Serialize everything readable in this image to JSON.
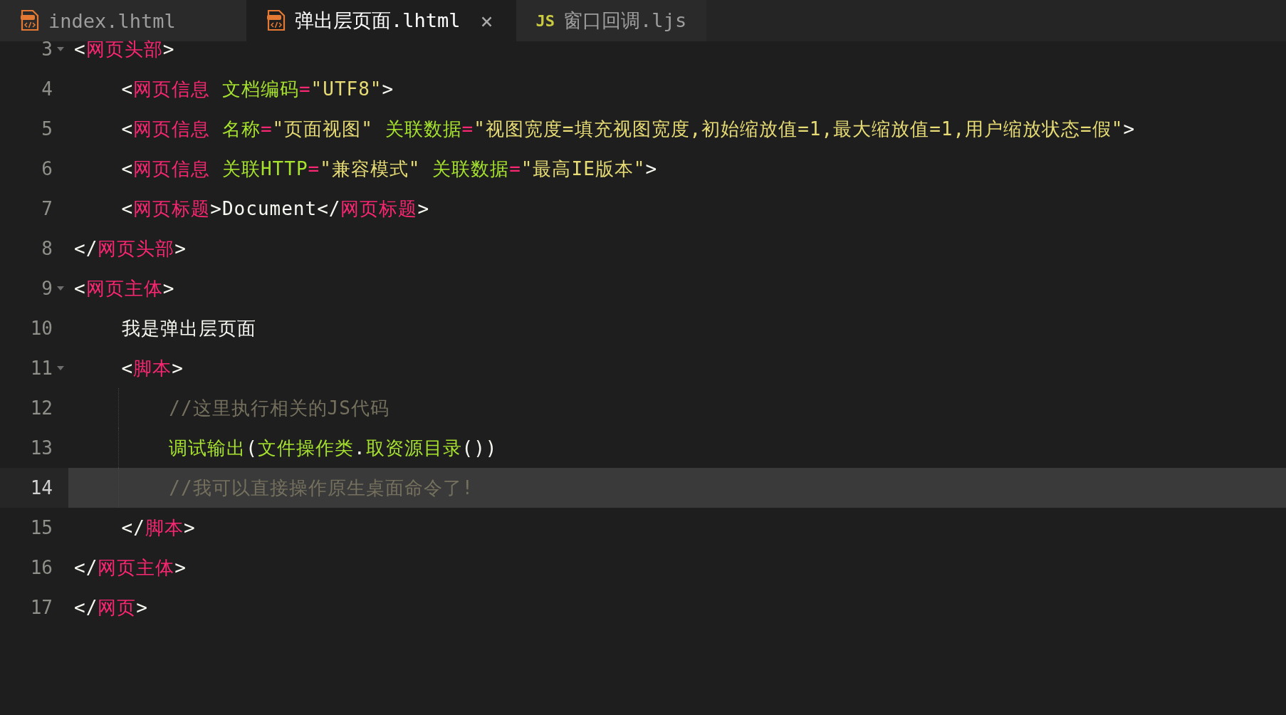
{
  "tabs": [
    {
      "label": "index.lhtml",
      "kind": "html",
      "selected": false
    },
    {
      "label": "弹出层页面.lhtml",
      "kind": "html",
      "selected": true,
      "close": "×"
    },
    {
      "label": "窗口回调.ljs",
      "kind": "js",
      "badge": "JS",
      "selected": false
    }
  ],
  "lines": [
    {
      "number": "3",
      "foldable": true,
      "selected": false,
      "tokens": [
        {
          "kind": "punct",
          "t": "<"
        },
        {
          "kind": "tag",
          "t": "网页头部"
        },
        {
          "kind": "punct",
          "t": ">"
        }
      ]
    },
    {
      "number": "4",
      "foldable": false,
      "selected": false,
      "tokens": [
        {
          "kind": "punct",
          "t": "    <"
        },
        {
          "kind": "tag",
          "t": "网页信息"
        },
        {
          "kind": "attr",
          "t": " 文档编码"
        },
        {
          "kind": "tag",
          "t": "="
        },
        {
          "kind": "string",
          "t": "\"UTF8\""
        },
        {
          "kind": "punct",
          "t": ">"
        }
      ]
    },
    {
      "number": "5",
      "foldable": false,
      "selected": false,
      "tokens": [
        {
          "kind": "punct",
          "t": "    <"
        },
        {
          "kind": "tag",
          "t": "网页信息"
        },
        {
          "kind": "attr",
          "t": " 名称"
        },
        {
          "kind": "tag",
          "t": "="
        },
        {
          "kind": "string",
          "t": "\"页面视图\""
        },
        {
          "kind": "attr",
          "t": " 关联数据"
        },
        {
          "kind": "tag",
          "t": "="
        },
        {
          "kind": "string",
          "t": "\"视图宽度=填充视图宽度,初始缩放值=1,最大缩放值=1,用户缩放状态=假\""
        },
        {
          "kind": "punct",
          "t": ">"
        }
      ]
    },
    {
      "number": "6",
      "foldable": false,
      "selected": false,
      "tokens": [
        {
          "kind": "punct",
          "t": "    <"
        },
        {
          "kind": "tag",
          "t": "网页信息"
        },
        {
          "kind": "attr",
          "t": " 关联HTTP"
        },
        {
          "kind": "tag",
          "t": "="
        },
        {
          "kind": "string",
          "t": "\"兼容模式\""
        },
        {
          "kind": "attr",
          "t": " 关联数据"
        },
        {
          "kind": "tag",
          "t": "="
        },
        {
          "kind": "string",
          "t": "\"最高IE版本\""
        },
        {
          "kind": "punct",
          "t": ">"
        }
      ]
    },
    {
      "number": "7",
      "foldable": false,
      "selected": false,
      "tokens": [
        {
          "kind": "punct",
          "t": "    <"
        },
        {
          "kind": "tag",
          "t": "网页标题"
        },
        {
          "kind": "punct",
          "t": ">Document</"
        },
        {
          "kind": "tag",
          "t": "网页标题"
        },
        {
          "kind": "punct",
          "t": ">"
        }
      ]
    },
    {
      "number": "8",
      "foldable": false,
      "selected": false,
      "tokens": [
        {
          "kind": "punct",
          "t": "</"
        },
        {
          "kind": "tag",
          "t": "网页头部"
        },
        {
          "kind": "punct",
          "t": ">"
        }
      ]
    },
    {
      "number": "9",
      "foldable": true,
      "selected": false,
      "tokens": [
        {
          "kind": "punct",
          "t": "<"
        },
        {
          "kind": "tag",
          "t": "网页主体"
        },
        {
          "kind": "punct",
          "t": ">"
        }
      ]
    },
    {
      "number": "10",
      "foldable": false,
      "selected": false,
      "tokens": [
        {
          "kind": "punct",
          "t": "    我是弹出层页面"
        }
      ]
    },
    {
      "number": "11",
      "foldable": true,
      "selected": false,
      "tokens": [
        {
          "kind": "punct",
          "t": "    <"
        },
        {
          "kind": "tag",
          "t": "脚本"
        },
        {
          "kind": "punct",
          "t": ">"
        }
      ]
    },
    {
      "number": "12",
      "foldable": false,
      "selected": false,
      "guide": true,
      "tokens": [
        {
          "kind": "comment",
          "t": "        //这里执行相关的JS代码"
        }
      ]
    },
    {
      "number": "13",
      "foldable": false,
      "selected": false,
      "guide": true,
      "tokens": [
        {
          "kind": "attr",
          "t": "        调试输出"
        },
        {
          "kind": "punct",
          "t": "("
        },
        {
          "kind": "attr",
          "t": "文件操作类"
        },
        {
          "kind": "punct",
          "t": "."
        },
        {
          "kind": "attr",
          "t": "取资源目录"
        },
        {
          "kind": "punct",
          "t": "())"
        }
      ]
    },
    {
      "number": "14",
      "foldable": false,
      "selected": true,
      "guide": true,
      "tokens": [
        {
          "kind": "comment",
          "t": "        //我可以直接操作原生桌面命令了!"
        }
      ]
    },
    {
      "number": "15",
      "foldable": false,
      "selected": false,
      "tokens": [
        {
          "kind": "punct",
          "t": "    </"
        },
        {
          "kind": "tag",
          "t": "脚本"
        },
        {
          "kind": "punct",
          "t": ">"
        }
      ]
    },
    {
      "number": "16",
      "foldable": false,
      "selected": false,
      "tokens": [
        {
          "kind": "punct",
          "t": "</"
        },
        {
          "kind": "tag",
          "t": "网页主体"
        },
        {
          "kind": "punct",
          "t": ">"
        }
      ]
    },
    {
      "number": "17",
      "foldable": false,
      "selected": false,
      "tokens": [
        {
          "kind": "punct",
          "t": "</"
        },
        {
          "kind": "tag",
          "t": "网页"
        },
        {
          "kind": "punct",
          "t": ">"
        }
      ]
    }
  ]
}
